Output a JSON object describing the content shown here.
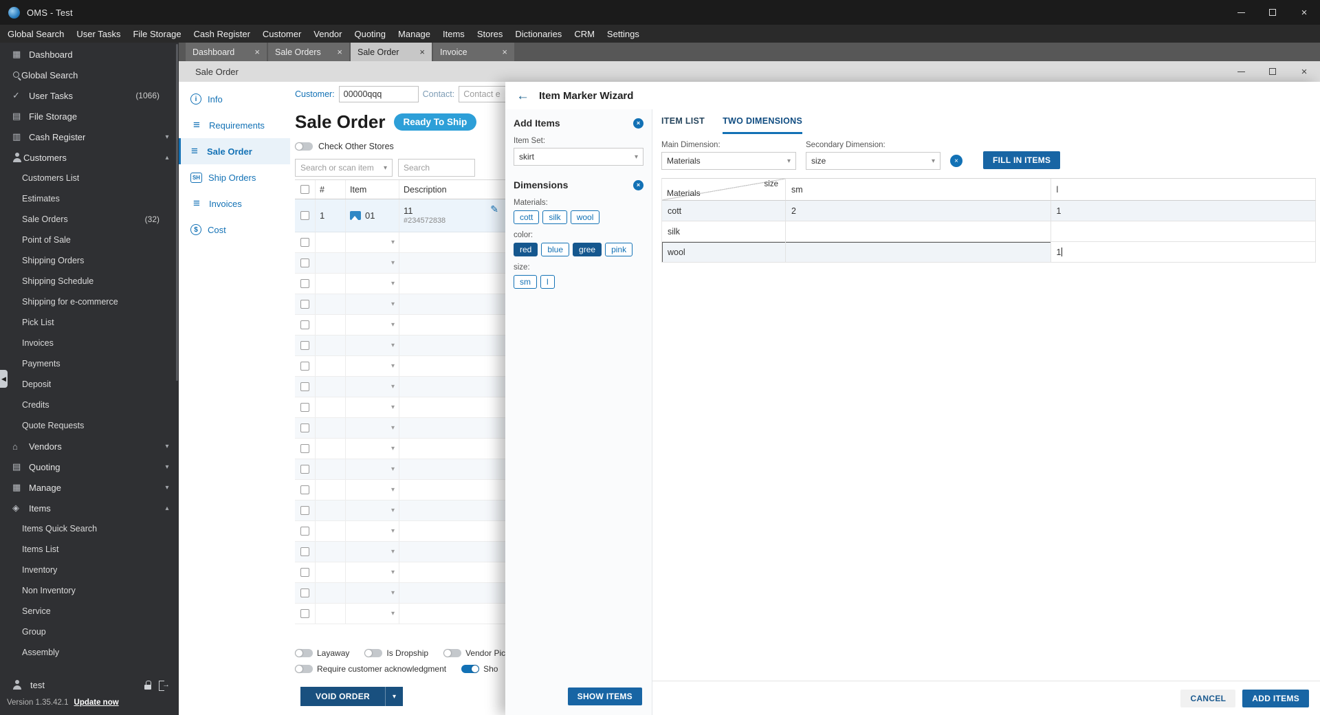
{
  "colors": {
    "accent": "#1271b5",
    "button_dark_blue": "#19507f",
    "button_blue": "#1865a4",
    "status_badge_blue": "#2d9fd8",
    "titlebar_bg": "#1b1b1b",
    "sidebar_bg": "#2f3033"
  },
  "titlebar": {
    "title": "OMS - Test"
  },
  "menubar": {
    "items": [
      "Global Search",
      "User Tasks",
      "File Storage",
      "Cash Register",
      "Customer",
      "Vendor",
      "Quoting",
      "Manage",
      "Items",
      "Stores",
      "Dictionaries",
      "CRM",
      "Settings"
    ]
  },
  "tabs": [
    {
      "label": "Dashboard",
      "active": false
    },
    {
      "label": "Sale Orders",
      "active": false
    },
    {
      "label": "Sale Order",
      "active": true
    },
    {
      "label": "Invoice",
      "active": false
    }
  ],
  "window": {
    "title": "Sale Order"
  },
  "sidebar": {
    "items": [
      {
        "label": "Dashboard",
        "icon": "dashboard"
      },
      {
        "label": "Global Search",
        "icon": "search"
      },
      {
        "label": "User Tasks",
        "icon": "tasks",
        "badge": "(1066)"
      },
      {
        "label": "File Storage",
        "icon": "storage"
      },
      {
        "label": "Cash Register",
        "icon": "cash",
        "chevron": "down"
      },
      {
        "label": "Customers",
        "icon": "customers",
        "chevron": "up"
      },
      {
        "label": "Customers List",
        "child": true
      },
      {
        "label": "Estimates",
        "child": true
      },
      {
        "label": "Sale Orders",
        "child": true,
        "badge": "(32)"
      },
      {
        "label": "Point of Sale",
        "child": true
      },
      {
        "label": "Shipping Orders",
        "child": true
      },
      {
        "label": "Shipping Schedule",
        "child": true
      },
      {
        "label": "Shipping for e-commerce",
        "child": true
      },
      {
        "label": "Pick List",
        "child": true
      },
      {
        "label": "Invoices",
        "child": true
      },
      {
        "label": "Payments",
        "child": true
      },
      {
        "label": "Deposit",
        "child": true
      },
      {
        "label": "Credits",
        "child": true
      },
      {
        "label": "Quote Requests",
        "child": true
      },
      {
        "label": "Vendors",
        "icon": "vendors",
        "chevron": "down"
      },
      {
        "label": "Quoting",
        "icon": "quoting",
        "chevron": "down"
      },
      {
        "label": "Manage",
        "icon": "manage",
        "chevron": "down"
      },
      {
        "label": "Items",
        "icon": "items",
        "chevron": "up"
      },
      {
        "label": "Items Quick Search",
        "child": true
      },
      {
        "label": "Items List",
        "child": true
      },
      {
        "label": "Inventory",
        "child": true
      },
      {
        "label": "Non Inventory",
        "child": true
      },
      {
        "label": "Service",
        "child": true
      },
      {
        "label": "Group",
        "child": true
      },
      {
        "label": "Assembly",
        "child": true
      }
    ],
    "user": "test",
    "version": "Version 1.35.42.1",
    "update_link": "Update now"
  },
  "form": {
    "customer_label": "Customer:",
    "customer_value": "00000qqq",
    "contact_label": "Contact:",
    "contact_placeholder": "Contact e",
    "nav": [
      {
        "label": "Info",
        "icon": "nav-info"
      },
      {
        "label": "Requirements",
        "icon": "nav-req"
      },
      {
        "label": "Sale Order",
        "icon": "nav-order",
        "active": true
      },
      {
        "label": "Ship Orders",
        "icon": "nav-ship"
      },
      {
        "label": "Invoices",
        "icon": "nav-inv"
      },
      {
        "label": "Cost",
        "icon": "nav-cost"
      }
    ],
    "title": "Sale Order",
    "status_badge": "Ready To Ship",
    "check_other_stores_label": "Check Other Stores",
    "item_search_placeholder": "Search or scan item",
    "search_placeholder": "Search",
    "table": {
      "headers": {
        "num": "#",
        "item": "Item",
        "description": "Description"
      },
      "row1": {
        "num": "1",
        "item": "01",
        "desc_title": "11",
        "desc_sub": "#234572838"
      },
      "empty_row_count": 19
    },
    "toggles_row1": [
      {
        "label": "Layaway"
      },
      {
        "label": "Is Dropship"
      },
      {
        "label": "Vendor Pic"
      }
    ],
    "toggles_row2": [
      {
        "label": "Require customer acknowledgment"
      },
      {
        "label": "Sho",
        "on": true
      }
    ],
    "void_order_label": "VOID ORDER"
  },
  "wizard": {
    "title": "Item Marker Wizard",
    "panel": {
      "add_items_title": "Add Items",
      "item_set_label": "Item Set:",
      "item_set_value": "skirt",
      "dimensions_title": "Dimensions",
      "groups": [
        {
          "label": "Materials:",
          "chips": [
            {
              "label": "cott"
            },
            {
              "label": "silk"
            },
            {
              "label": "wool"
            }
          ]
        },
        {
          "label": "color:",
          "chips": [
            {
              "label": "red",
              "selected": true
            },
            {
              "label": "blue"
            },
            {
              "label": "gree",
              "selected": true
            },
            {
              "label": "pink"
            }
          ]
        },
        {
          "label": "size:",
          "chips": [
            {
              "label": "sm"
            },
            {
              "label": "l"
            }
          ]
        }
      ],
      "show_items_label": "SHOW ITEMS"
    },
    "tabs": [
      {
        "label": "ITEM LIST",
        "active": false
      },
      {
        "label": "TWO DIMENSIONS",
        "active": true
      }
    ],
    "main_dimension_label": "Main Dimension:",
    "main_dimension_value": "Materials",
    "secondary_dimension_label": "Secondary Dimension:",
    "secondary_dimension_value": "size",
    "fill_in_items_label": "FILL IN ITEMS",
    "grid": {
      "corner_main": "Materials",
      "corner_secondary": "size",
      "columns": [
        "sm",
        "l"
      ],
      "rows": [
        {
          "label": "cott",
          "values": [
            "2",
            "1"
          ]
        },
        {
          "label": "silk",
          "values": [
            "",
            ""
          ]
        },
        {
          "label": "wool",
          "values": [
            "",
            "1"
          ],
          "focused": true
        }
      ]
    },
    "cancel_label": "CANCEL",
    "add_items_label": "ADD ITEMS"
  }
}
